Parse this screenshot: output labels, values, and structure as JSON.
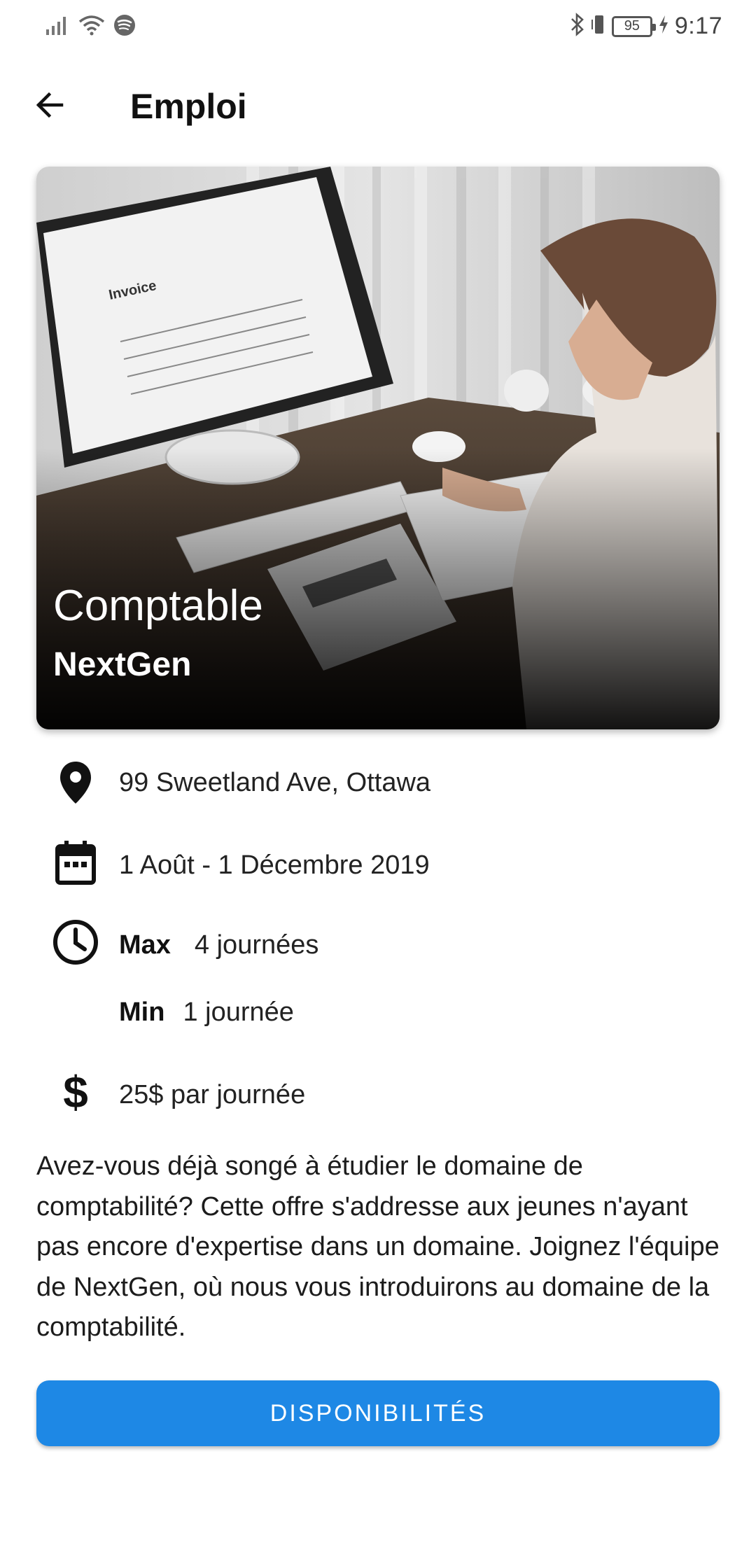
{
  "status_bar": {
    "time": "9:17",
    "battery_level": "95",
    "icons": [
      "signal-icon",
      "wifi-icon",
      "spotify-icon",
      "bluetooth-icon",
      "vibrate-icon",
      "battery-icon",
      "charging-icon"
    ]
  },
  "app_bar": {
    "title": "Emploi",
    "back_icon": "arrow-left-icon"
  },
  "job": {
    "title": "Comptable",
    "company": "NextGen",
    "image_description_icon": "accountant-photo",
    "address": "99 Sweetland Ave, Ottawa",
    "dates": "1 Août - 1 Décembre 2019",
    "max_label": "Max",
    "max_value": "4 journées",
    "min_label": "Min",
    "min_value": "1 journée",
    "pay": "25$ par journée",
    "description": "Avez-vous déjà songé à étudier le domaine de comptabilité? Cette offre s'addresse aux jeunes n'ayant pas encore d'expertise dans un domaine. Joignez l'équipe de NextGen, où nous vous introduirons au domaine de la comptabilité."
  },
  "actions": {
    "availability_button": "DISPONIBILITÉS"
  },
  "colors": {
    "primary": "#1e88e5",
    "text": "#1c1c1c",
    "background": "#ffffff"
  }
}
